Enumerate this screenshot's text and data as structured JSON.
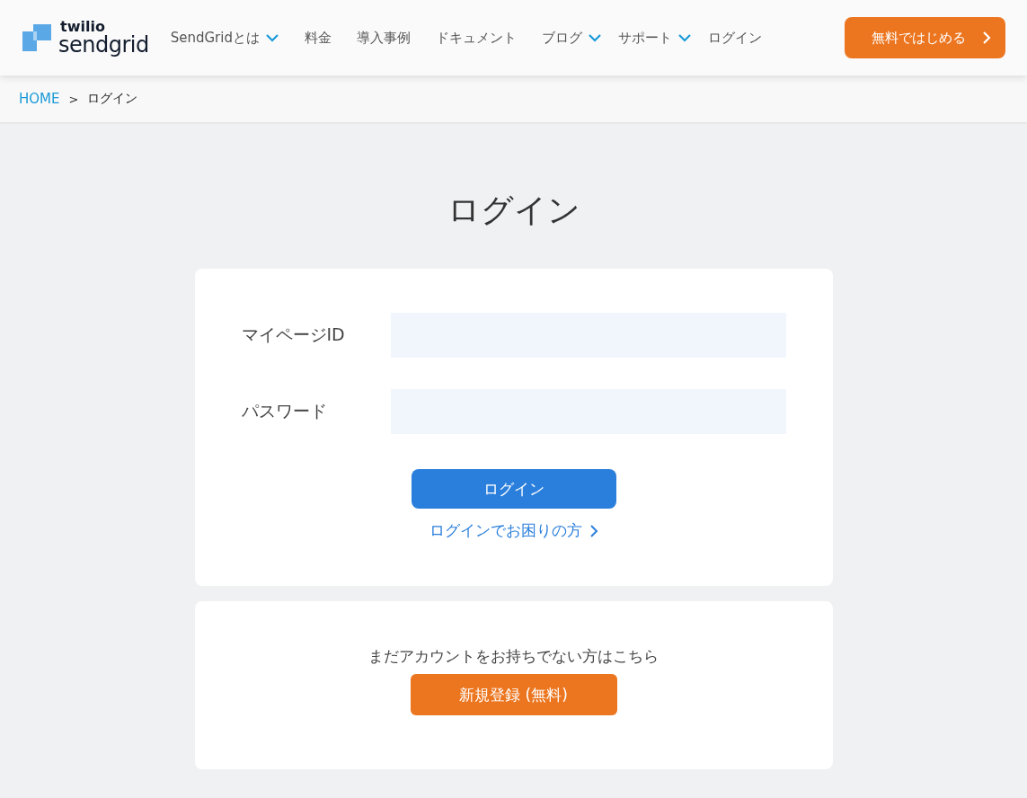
{
  "header": {
    "logo": {
      "top": "twilio",
      "bottom": "sendgrid"
    },
    "nav": [
      {
        "label": "SendGridとは",
        "has_menu": true
      },
      {
        "label": "料金",
        "has_menu": false
      },
      {
        "label": "導入事例",
        "has_menu": false
      },
      {
        "label": "ドキュメント",
        "has_menu": false
      },
      {
        "label": "ブログ",
        "has_menu": true
      },
      {
        "label": "サポート",
        "has_menu": true
      },
      {
        "label": "ログイン",
        "has_menu": false
      }
    ],
    "cta": "無料ではじめる"
  },
  "breadcrumb": [
    {
      "label": "HOME",
      "kind": "link"
    },
    {
      "label": ">",
      "kind": "separator"
    },
    {
      "label": "ログイン",
      "kind": "current"
    }
  ],
  "title": "ログイン",
  "login_form": {
    "fields": [
      {
        "label": "マイページID"
      },
      {
        "label": "パスワード"
      }
    ],
    "submit": "ログイン",
    "help_link": "ログインでお困りの方"
  },
  "signup": {
    "text": "まだアカウントをお持ちでない方はこちら",
    "button": "新規登録 (無料)"
  }
}
